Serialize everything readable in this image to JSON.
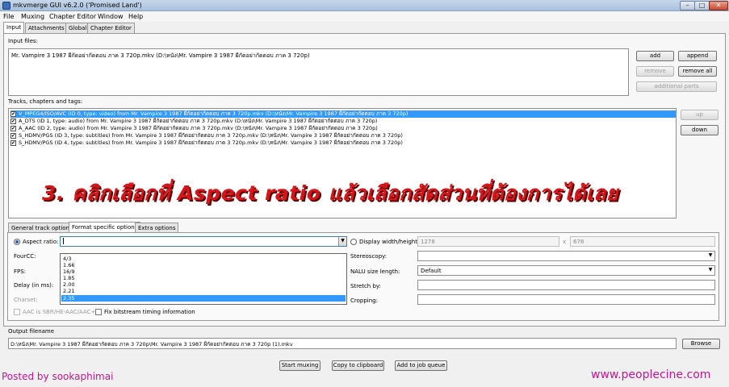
{
  "window": {
    "title": "mkvmerge GUI v6.2.0 ('Promised Land')",
    "min": "–",
    "max": "□",
    "close": "✕"
  },
  "menu": [
    "File",
    "Muxing",
    "Chapter Editor",
    "Window",
    "Help"
  ],
  "main_tabs": [
    "Input",
    "Attachments",
    "Global",
    "Chapter Editor"
  ],
  "input_files": {
    "label": "Input files:",
    "items": [
      "Mr. Vampire 3 1987 ผีกัดอย่ากัดตอบ ภาค 3 720p.mkv (D:\\หนัง\\Mr. Vampire 3 1987 ผีกัดอย่ากัดตอบ ภาค 3 720p)"
    ],
    "buttons": {
      "add": "add",
      "append": "append",
      "remove": "remove",
      "remove_all": "remove all",
      "additional_parts": "additional parts"
    }
  },
  "tracks": {
    "label": "Tracks, chapters and tags:",
    "items": [
      "V_MPEG4/ISO/AVC (ID 0, type: video) from Mr. Vampire 3 1987 ผีกัดอย่ากัดตอบ ภาค 3 720p.mkv (D:\\หนัง\\Mr. Vampire 3 1987 ผีกัดอย่ากัดตอบ ภาค 3 720p)",
      "A_DTS (ID 1, type: audio) from Mr. Vampire 3 1987 ผีกัดอย่ากัดตอบ ภาค 3 720p.mkv (D:\\หนัง\\Mr. Vampire 3 1987 ผีกัดอย่ากัดตอบ ภาค 3 720p)",
      "A_AAC (ID 2, type: audio) from Mr. Vampire 3 1987 ผีกัดอย่ากัดตอบ ภาค 3 720p.mkv (D:\\หนัง\\Mr. Vampire 3 1987 ผีกัดอย่ากัดตอบ ภาค 3 720p)",
      "S_HDMV/PGS (ID 3, type: subtitles) from Mr. Vampire 3 1987 ผีกัดอย่ากัดตอบ ภาค 3 720p.mkv (D:\\หนัง\\Mr. Vampire 3 1987 ผีกัดอย่ากัดตอบ ภาค 3 720p)",
      "S_HDMV/PGS (ID 4, type: subtitles) from Mr. Vampire 3 1987 ผีกัดอย่ากัดตอบ ภาค 3 720p.mkv (D:\\หนัง\\Mr. Vampire 3 1987 ผีกัดอย่ากัดตอบ ภาค 3 720p)"
    ],
    "check_mark": "✔",
    "buttons": {
      "up": "up",
      "down": "down"
    }
  },
  "overlay": "3. คลิกเลือกที่ Aspect ratio แล้วเลือกสัดส่วนที่ต้องการได้เลย",
  "sub_tabs": [
    "General track options",
    "Format specific options",
    "Extra options"
  ],
  "format": {
    "aspect_ratio_label": "Aspect ratio:",
    "aspect_ratio_value": "",
    "aspect_options": [
      "4/3",
      "1.66",
      "16/9",
      "1.85",
      "2.00",
      "2.21",
      "2.35"
    ],
    "fourcc_label": "FourCC:",
    "fps_label": "FPS:",
    "delay_label": "Delay (in ms):",
    "charset_label": "Charset:",
    "aac_label": "AAC is SBR/HE-AAC/AAC+",
    "fix_bitstream_label": "Fix bitstream timing information",
    "display_wh_label": "Display width/height:",
    "width": "1278",
    "height": "678",
    "x": "x",
    "stereoscopy_label": "Stereoscopy:",
    "nalu_label": "NALU size length:",
    "nalu_value": "Default",
    "stretch_label": "Stretch by:",
    "cropping_label": "Cropping:",
    "arrow": "▼"
  },
  "output": {
    "label": "Output filename",
    "value": "D:\\หนัง\\Mr. Vampire 3 1987 ผีกัดอย่ากัดตอบ ภาค 3 720p\\Mr. Vampire 3 1987 ผีกัดอย่ากัดตอบ ภาค 3 720p (1).mkv",
    "browse": "Browse"
  },
  "actions": {
    "start": "Start muxing",
    "copy": "Copy to clipboard",
    "queue": "Add to job queue"
  },
  "footer": {
    "left": "Posted by sookaphimai",
    "right": "www.peoplecine.com"
  },
  "colors": {
    "selection": "#3399ff",
    "overlay_text": "#d4161b",
    "watermark": "#c3168e"
  }
}
